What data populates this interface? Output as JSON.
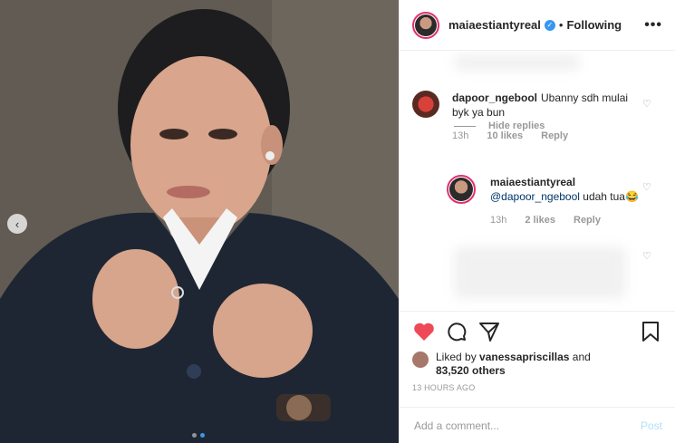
{
  "post": {
    "author": "maiaestiantyreal",
    "follow_status": "Following",
    "more_icon": "•••",
    "carousel": {
      "prev_icon": "‹",
      "slide_count": 2,
      "active_slide": 2
    }
  },
  "comments": [
    {
      "user": "dapoor_ngebool",
      "text": "Ubanny sdh mulai byk ya bun",
      "time": "13h",
      "likes": "10 likes",
      "reply_label": "Reply"
    }
  ],
  "hide_replies_label": "Hide replies",
  "reply": {
    "user": "maiaestiantyreal",
    "mention": "@dapoor_ngebool",
    "text": " udah tua😂",
    "time": "13h",
    "likes": "2 likes",
    "reply_label": "Reply"
  },
  "likes": {
    "prefix": "Liked by ",
    "user": "vanessapriscillas",
    "and": " and",
    "others": "83,520 others"
  },
  "timestamp": "13 HOURS AGO",
  "add_comment": {
    "placeholder": "Add a comment...",
    "post_label": "Post"
  },
  "colors": {
    "like_red": "#ed4956",
    "verified_blue": "#3897f0",
    "post_light_blue": "#b2dffc"
  }
}
